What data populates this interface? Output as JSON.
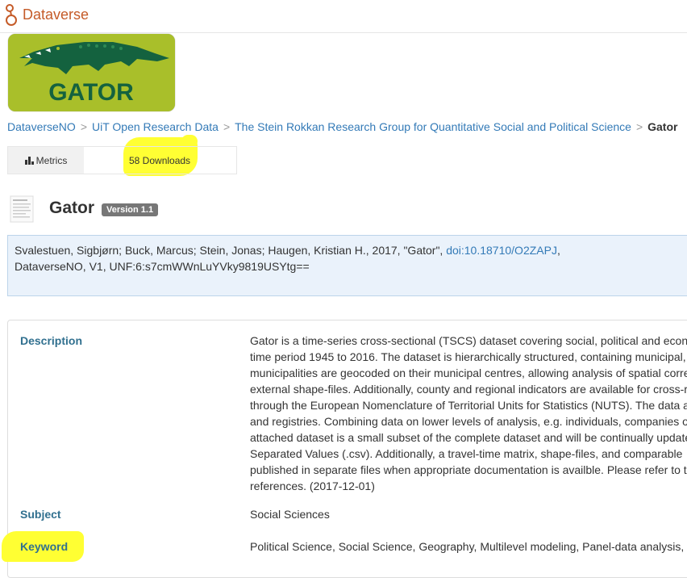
{
  "header": {
    "brand": "Dataverse"
  },
  "logo": {
    "text": "GATOR"
  },
  "breadcrumb": {
    "items": [
      "DataverseNO",
      "UiT Open Research Data",
      "The Stein Rokkan Research Group for Quantitative Social and Political Science"
    ],
    "current": "Gator",
    "separator": ">"
  },
  "metrics": {
    "tab_label": "Metrics",
    "downloads": "58 Downloads"
  },
  "dataset": {
    "title": "Gator",
    "version": "Version 1.1"
  },
  "citation": {
    "text_before": "Svalestuen, Sigbjørn; Buck, Marcus; Stein, Jonas; Haugen, Kristian H., 2017, \"Gator\",",
    "doi": "doi:10.18710/O2ZAPJ",
    "text_after": ",",
    "line2": "DataverseNO, V1, UNF:6:s7cmWWnLuYVky9819USYtg=="
  },
  "metadata": {
    "description_label": "Description",
    "description_lines": [
      "Gator is a time-series cross-sectional (TSCS) dataset covering social, political and econ",
      "time period 1945 to 2016. The dataset is hierarchically structured, containing municipal,",
      "municipalities are geocoded on their municipal centres, allowing analysis of spatial corre",
      "external shape-files. Additionally, county and regional indicators are available for cross-r",
      "through the European Nomenclature of Territorial Units for Statistics (NUTS). The data a",
      "and registries. Combining data on lower levels of analysis, e.g. individuals, companies o",
      "attached dataset is a small subset of the complete dataset and will be continually update",
      "Separated Values (.csv). Additionally, a travel-time matrix, shape-files, and comparable",
      "published in separate files when appropriate documentation is availble. Please refer to t",
      "references. (2017-12-01)"
    ],
    "subject_label": "Subject",
    "subject_value": "Social Sciences",
    "keyword_label": "Keyword",
    "keyword_value": "Political Science, Social Science, Geography, Multilevel modeling, Panel-data analysis,"
  },
  "colors": {
    "brand": "#c55b28",
    "link": "#337ab7",
    "label": "#31708f",
    "highlight": "#ffff33",
    "logo_bg": "#a9bf2a",
    "gator": "#14623f"
  },
  "icons": {
    "brand": "dataverse-icon",
    "metrics": "bar-chart-icon",
    "thumbnail": "document-icon"
  }
}
